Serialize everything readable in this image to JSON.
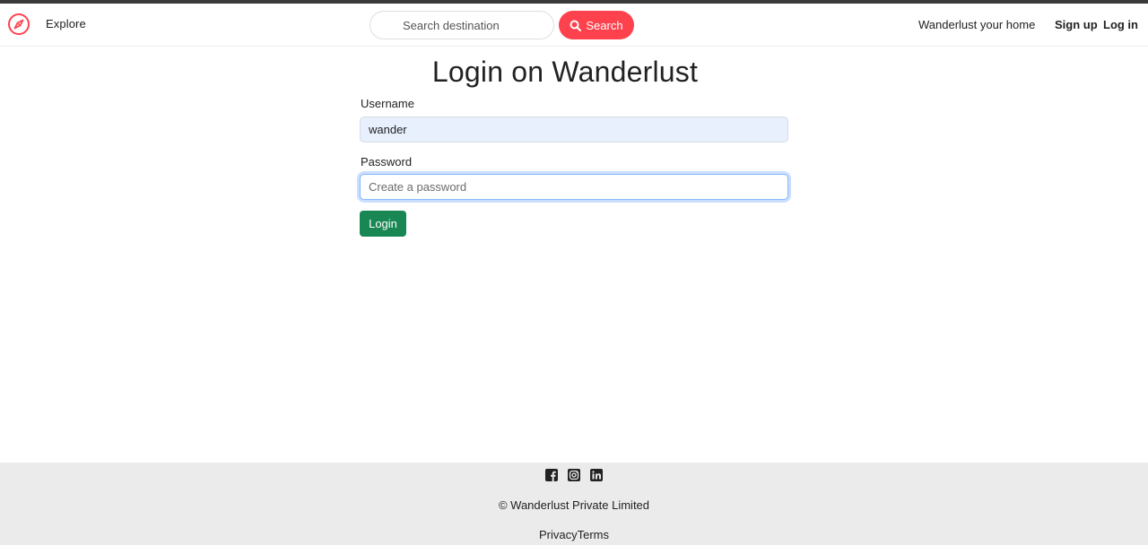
{
  "navbar": {
    "explore_label": "Explore",
    "search_placeholder": "Search destination",
    "search_button_label": "Search",
    "home_link": "Wanderlust your home",
    "signup_label": "Sign up",
    "login_label": "Log in"
  },
  "form": {
    "title": "Login on Wanderlust",
    "username_label": "Username",
    "username_value": "wander",
    "password_label": "Password",
    "password_placeholder": "Create a password",
    "submit_label": "Login"
  },
  "footer": {
    "social": [
      "facebook-icon",
      "instagram-icon",
      "linkedin-icon"
    ],
    "copyright": "© Wanderlust Private Limited",
    "privacy_label": "Privacy",
    "terms_label": "Terms"
  },
  "colors": {
    "brand": "#fe424d",
    "login_button": "#198754",
    "footer_bg": "#ebebeb"
  }
}
